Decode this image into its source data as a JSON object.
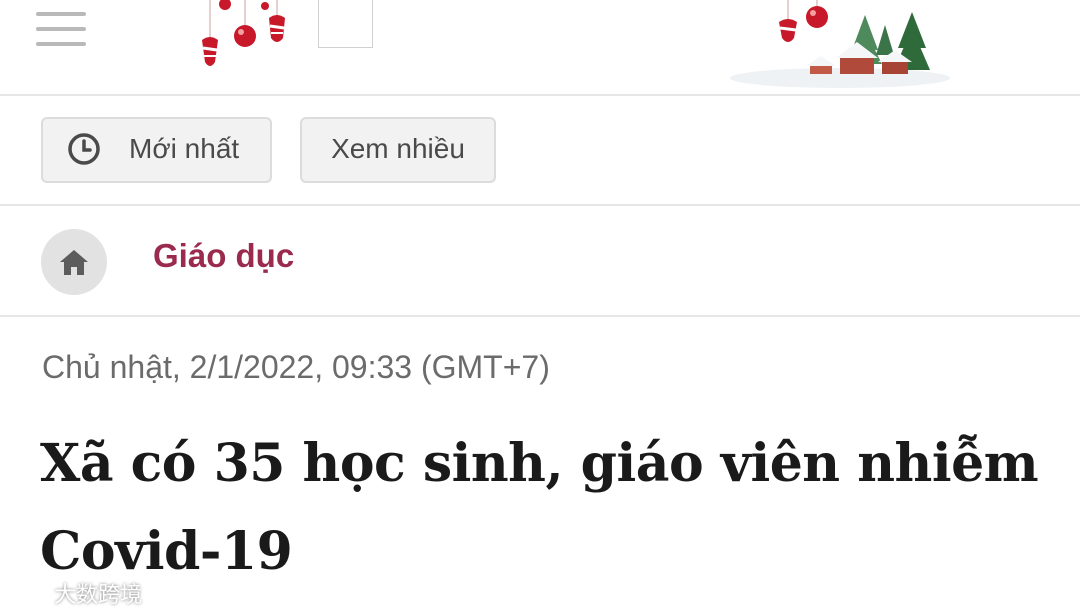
{
  "header": {
    "menu_icon": "hamburger-menu-icon",
    "decoration_left": "christmas-ornaments-icon",
    "decoration_right": "christmas-village-icon"
  },
  "filters": {
    "newest_label": "Mới nhất",
    "newest_icon": "clock-icon",
    "popular_label": "Xem nhiều"
  },
  "breadcrumb": {
    "home_icon": "home-icon",
    "category": "Giáo dục"
  },
  "article": {
    "date": "Chủ nhật, 2/1/2022, 09:33 (GMT+7)",
    "title": "Xã có 35 học sinh, giáo viên nhiễm Covid-19"
  },
  "watermark": {
    "text": "大数跨境"
  },
  "colors": {
    "category": "#9a2a4e",
    "ornament_red": "#c8192a",
    "tree_green": "#2f6b3a"
  }
}
